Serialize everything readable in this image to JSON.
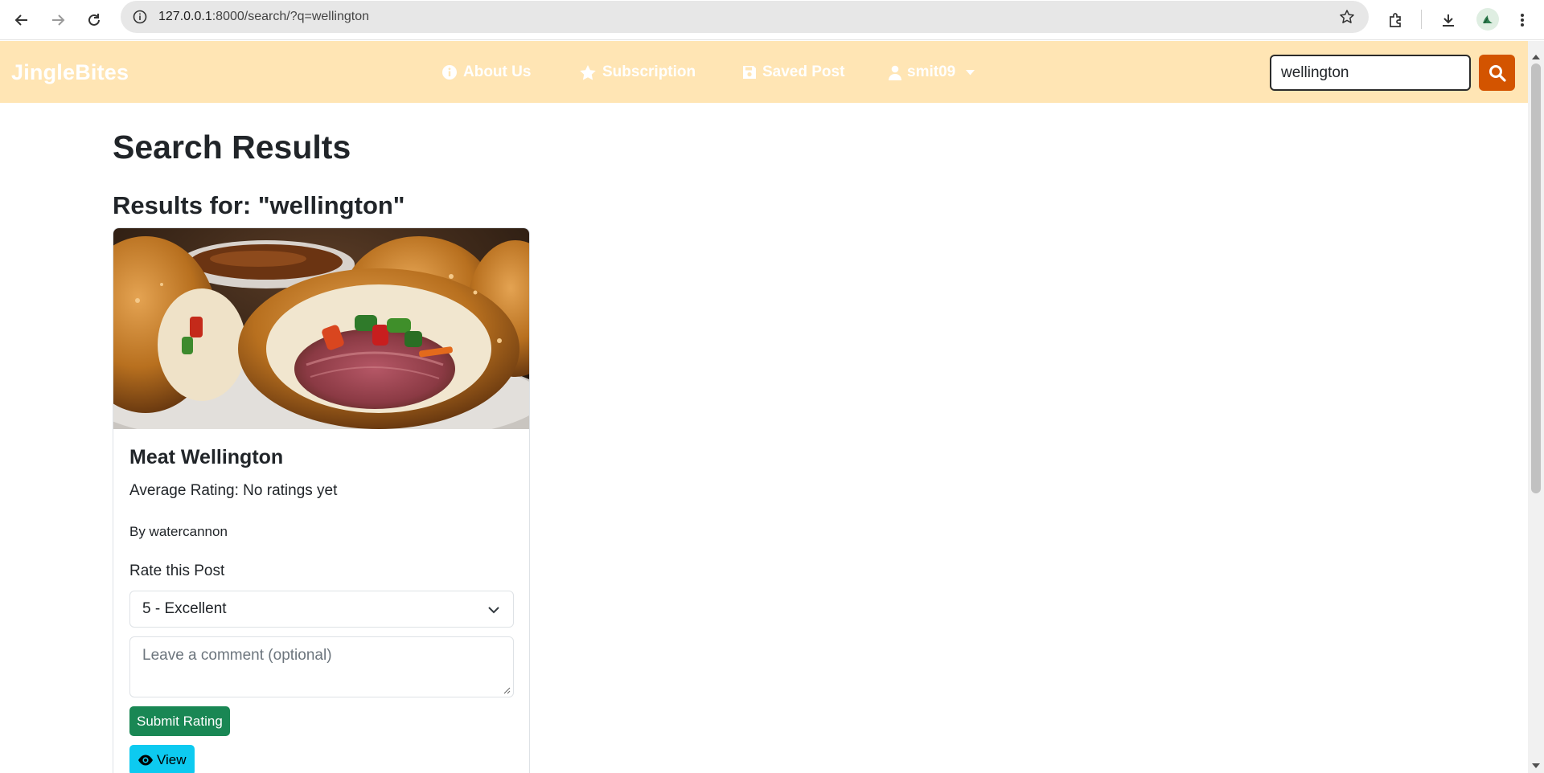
{
  "browser": {
    "url_host": "127.0.0.1",
    "url_rest": ":8000/search/?q=wellington"
  },
  "navbar": {
    "brand": "JingleBites",
    "about": "About Us",
    "subscription": "Subscription",
    "saved": "Saved Post",
    "user": "smit09",
    "search_value": "wellington",
    "color_bg": "#ffe5b4",
    "color_search_button": "#d35400"
  },
  "page": {
    "title": "Search Results",
    "results_for": "Results for: \"wellington\""
  },
  "results": [
    {
      "title": "Meat Wellington",
      "rating": "Average Rating: No ratings yet",
      "author": "By watercannon",
      "rate_label": "Rate this Post",
      "rate_selected": "5 - Excellent",
      "comment_placeholder": "Leave a comment (optional)",
      "submit_label": "Submit Rating",
      "view_label": "View"
    }
  ]
}
